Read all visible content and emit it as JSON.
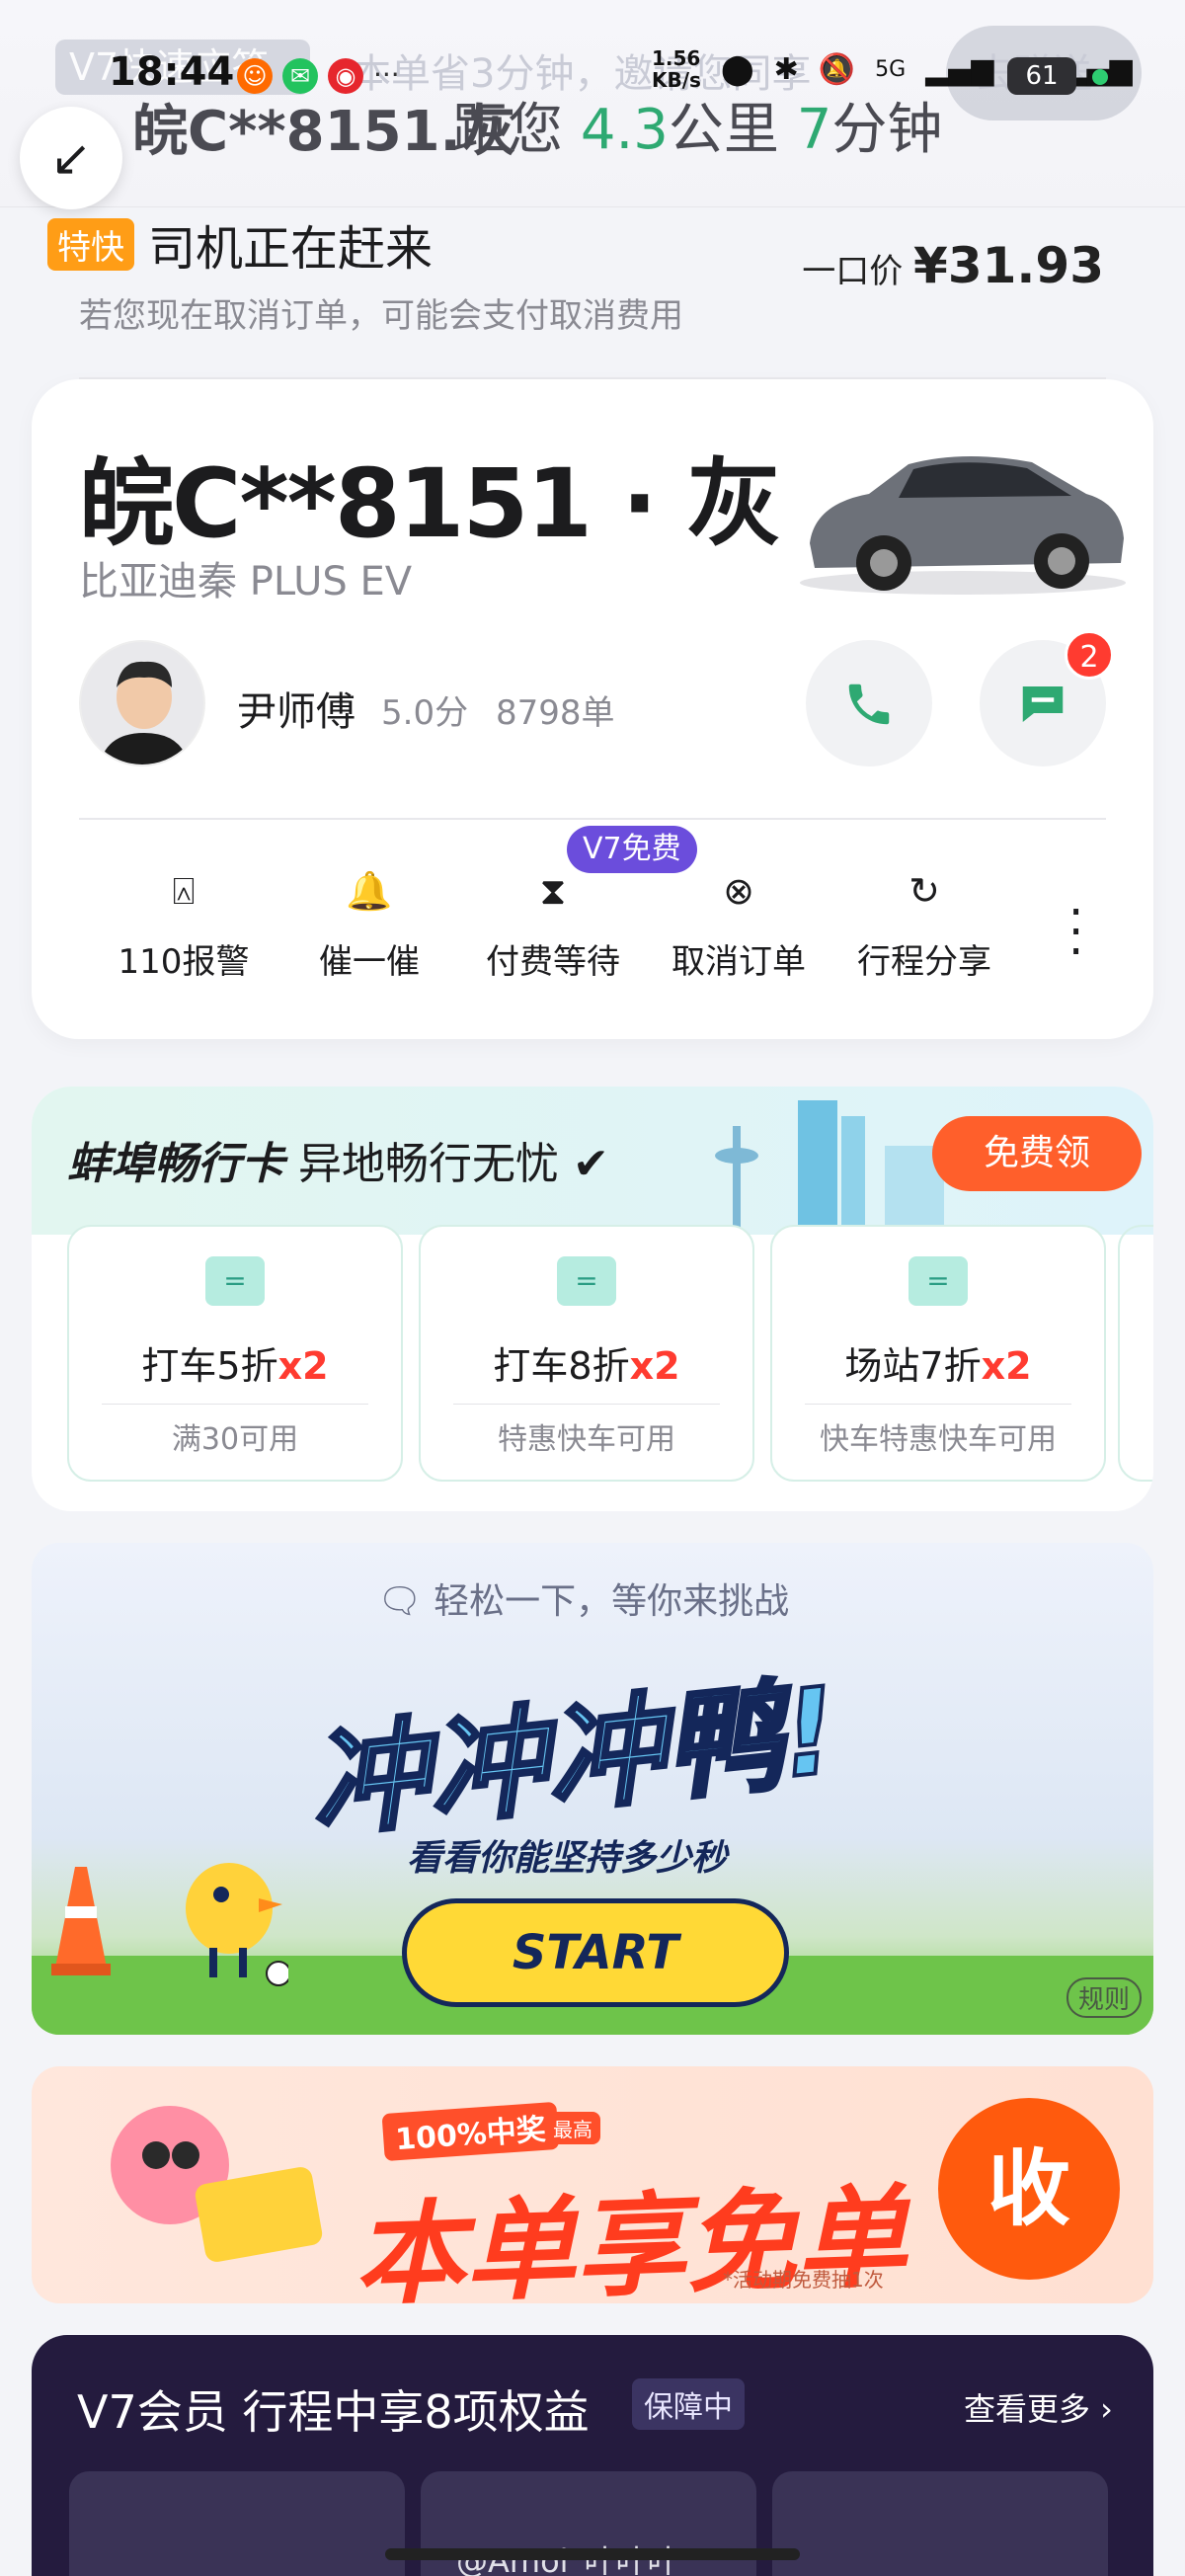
{
  "status_bar": {
    "time": "18:44",
    "net_speed": "1.56 KB/s",
    "signal1": "5G",
    "signal2": "5G",
    "battery": "61"
  },
  "ghost_banner": {
    "tag": "V7快速应答",
    "text": "本单省3分钟，邀请您同享",
    "right": "去赠送"
  },
  "header": {
    "plate": "皖C**8151.灰",
    "distance_prefix": "距您",
    "distance_km": "4.3",
    "distance_unit": "公里",
    "eta_min": "7",
    "eta_unit": "分钟"
  },
  "order": {
    "service_tag": "特快",
    "status": "司机正在赶来",
    "cancel_note": "若您现在取消订单，可能会支付取消费用",
    "price_label": "一口价",
    "price": "¥31.93"
  },
  "driver": {
    "plate": "皖C**8151 · 灰",
    "car_model": "比亚迪秦 PLUS EV",
    "name": "尹师傅",
    "rating": "5.0分",
    "orders": "8798单",
    "message_badge": "2"
  },
  "actions": [
    {
      "label": "110报警",
      "icon": "alarm-110-icon"
    },
    {
      "label": "催一催",
      "icon": "bell-icon"
    },
    {
      "label": "付费等待",
      "icon": "hourglass-icon"
    },
    {
      "label": "取消订单",
      "icon": "cancel-circle-icon"
    },
    {
      "label": "行程分享",
      "icon": "share-icon"
    }
  ],
  "v7_free_tag": "V7免费",
  "city_pass": {
    "title": "蚌埠畅行卡",
    "subtitle": "异地畅行无忧",
    "button": "免费领",
    "coupons": [
      {
        "name": "打车5折",
        "mult": "x2",
        "note": "满30可用"
      },
      {
        "name": "打车8折",
        "mult": "x2",
        "note": "特惠快车可用"
      },
      {
        "name": "场站7折",
        "mult": "x2",
        "note": "快车特惠快车可用"
      }
    ]
  },
  "game": {
    "subtitle": "轻松一下，等你来挑战",
    "title": "冲冲冲鸭!",
    "slogan": "看看你能坚持多少秒",
    "start": "START",
    "rule": "规则"
  },
  "free_order": {
    "tag": "100%中奖",
    "tag_small": "最高",
    "main": "本单享免单",
    "note": "*活动期免费抽1次",
    "button": "收"
  },
  "v7": {
    "title": "V7会员 行程中享8项权益",
    "badge": "保障中",
    "more": "查看更多 ›"
  },
  "watermark": "@Amol_叶叶叶",
  "colors": {
    "accent_green": "#2ea972",
    "orange": "#ff9d16",
    "red": "#ff3b30",
    "purple": "#6b4ddc"
  }
}
